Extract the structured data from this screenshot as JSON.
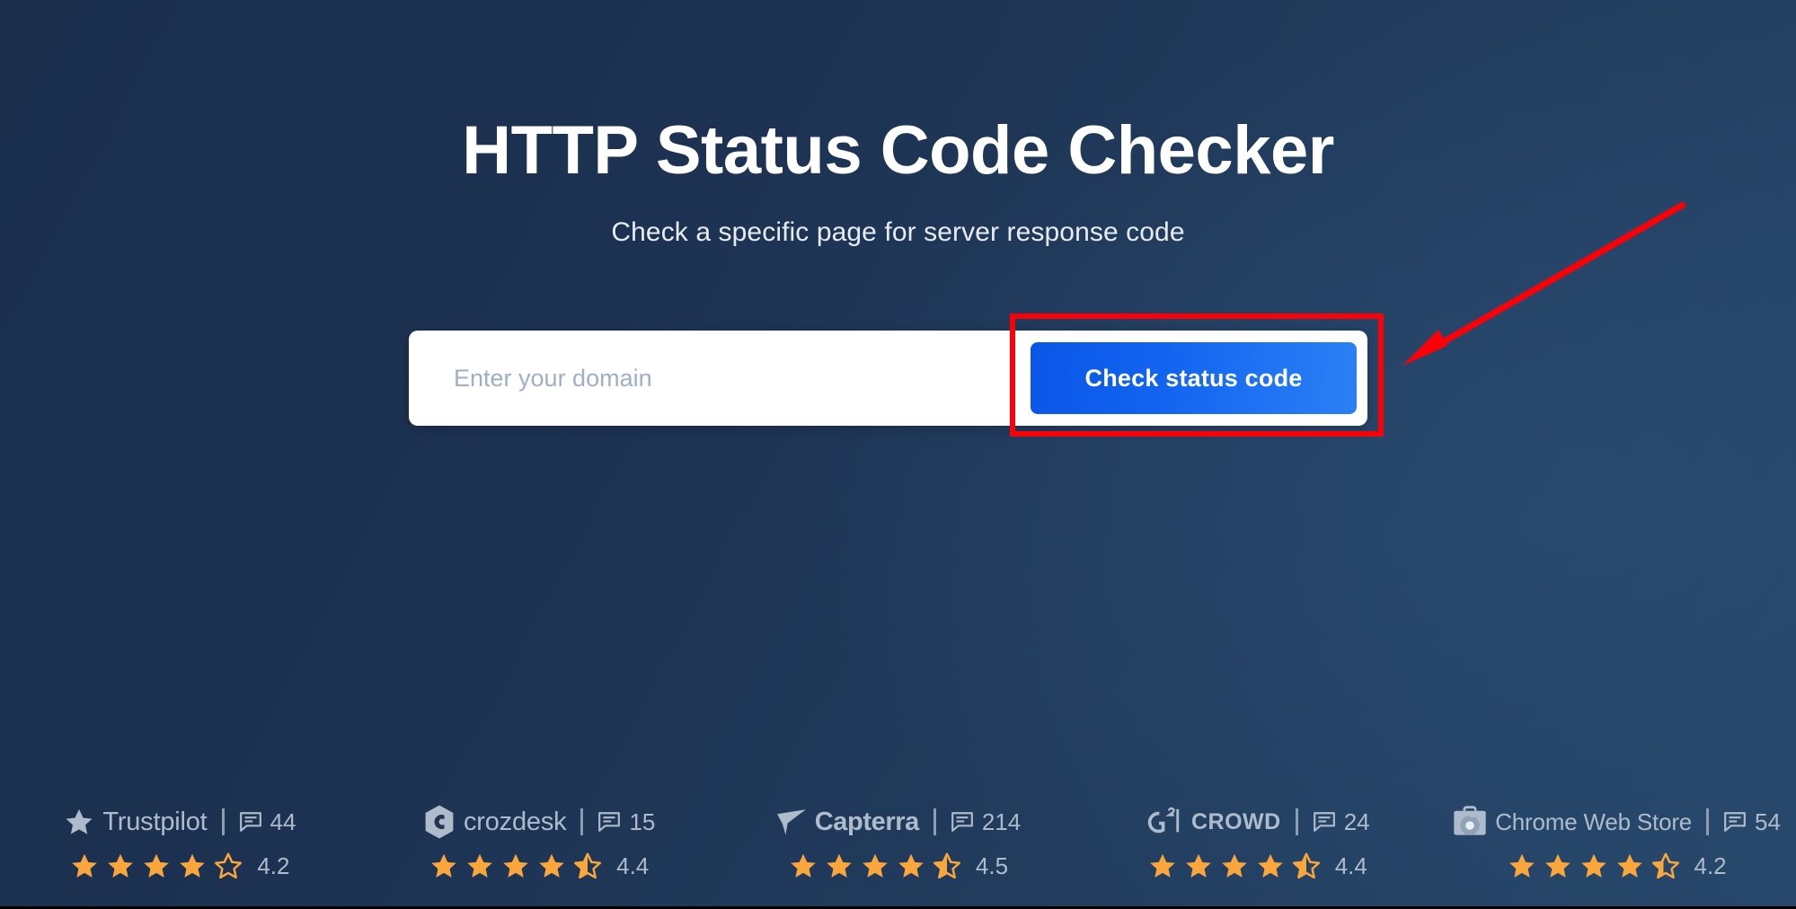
{
  "hero": {
    "title": "HTTP Status Code Checker",
    "subtitle": "Check a specific page for server response code"
  },
  "search": {
    "placeholder": "Enter your domain",
    "value": "",
    "button_label": "Check status code",
    "button_gradient_from": "#0b56e8",
    "button_gradient_to": "#2c80f5"
  },
  "annotation": {
    "highlight_color": "#fb0007",
    "target": "check-status-code-button"
  },
  "theme": {
    "background_from": "#1a2e4c",
    "background_to": "#264769",
    "star_color": "#fba63c",
    "muted_text": "#aebbca"
  },
  "reviews": [
    {
      "brand": "Trustpilot",
      "logo": "trustpilot-star-logo",
      "count": "44",
      "rating": "4.2",
      "full_stars": 4,
      "half_star": false,
      "empty_stars": 1
    },
    {
      "brand": "crozdesk",
      "logo": "crozdesk-hexagon-logo",
      "count": "15",
      "rating": "4.4",
      "full_stars": 4,
      "half_star": true,
      "empty_stars": 0
    },
    {
      "brand": "Capterra",
      "logo": "capterra-arrow-logo",
      "count": "214",
      "rating": "4.5",
      "full_stars": 4,
      "half_star": true,
      "empty_stars": 0
    },
    {
      "brand": "CROWD",
      "logo": "g2-crowd-logo",
      "count": "24",
      "rating": "4.4",
      "full_stars": 4,
      "half_star": true,
      "empty_stars": 0
    },
    {
      "brand": "Chrome Web Store",
      "logo": "chrome-web-store-logo",
      "count": "54",
      "rating": "4.2",
      "full_stars": 4,
      "half_star": true,
      "empty_stars": 0
    }
  ]
}
